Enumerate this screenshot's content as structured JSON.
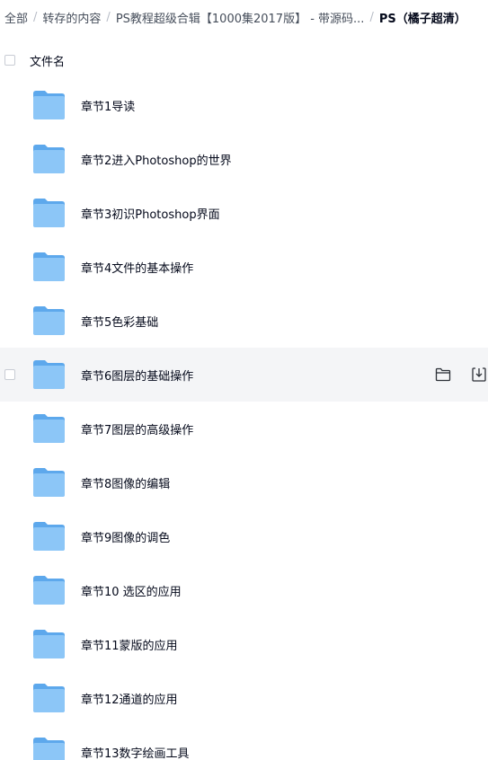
{
  "breadcrumb": {
    "items": [
      "全部",
      "转存的内容",
      "PS教程超级合辑【1000集2017版】 - 带源码...",
      "PS（橘子超清）"
    ],
    "separator": "/"
  },
  "list": {
    "header_label": "文件名",
    "rows": [
      {
        "name": "章节1导读"
      },
      {
        "name": "章节2进入Photoshop的世界"
      },
      {
        "name": "章节3初识Photoshop界面"
      },
      {
        "name": "章节4文件的基本操作"
      },
      {
        "name": "章节5色彩基础"
      },
      {
        "name": "章节6图层的基础操作"
      },
      {
        "name": "章节7图层的高级操作"
      },
      {
        "name": "章节8图像的编辑"
      },
      {
        "name": "章节9图像的调色"
      },
      {
        "name": "章节10 选区的应用"
      },
      {
        "name": "章节11蒙版的应用"
      },
      {
        "name": "章节12通道的应用"
      },
      {
        "name": "章节13数字绘画工具"
      }
    ],
    "hovered_row_index": 5,
    "row_action_icons": [
      "folder-outline-icon",
      "download-icon"
    ]
  },
  "colors": {
    "folder_back": "#5da8ec",
    "folder_front": "#8cc6f7",
    "hover_background": "#f4f5f7",
    "text": "#03081a",
    "breadcrumb_text": "#454d5a"
  }
}
